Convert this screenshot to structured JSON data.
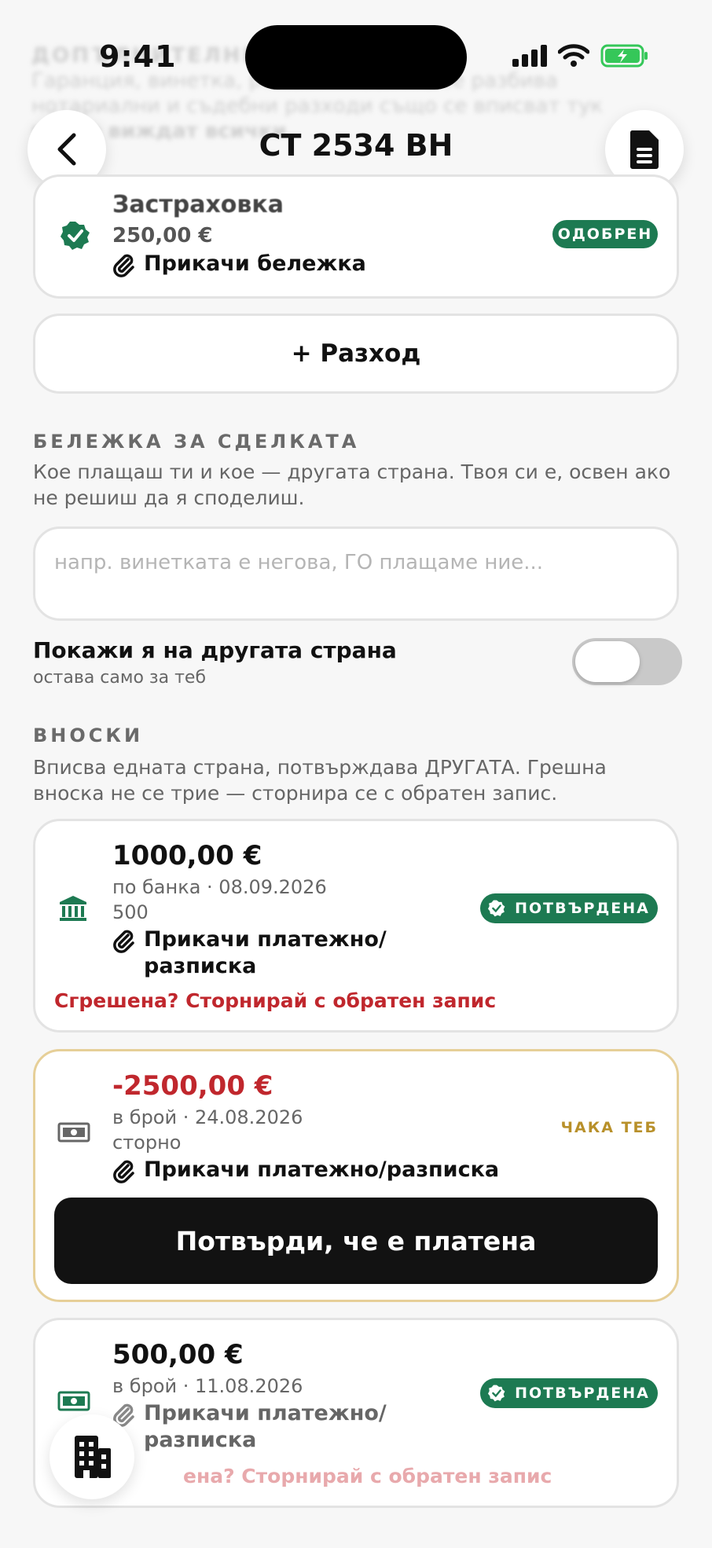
{
  "status_bar": {
    "time": "9:41"
  },
  "background_text": {
    "line1": "ДОПЪЛНИТЕЛНИ",
    "line2": "Гаранция, винетка, ремонт — всичко се разбива",
    "line3": "нотариални и съдебни разходи също се вписват тук",
    "line4": "ва, не виждат всички"
  },
  "header": {
    "title": "СТ 2534 ВН"
  },
  "expense": {
    "name": "Застраховка",
    "amount": "250,00 €",
    "attach_label": "Прикачи бележка",
    "badge": "ОДОБРЕН"
  },
  "add_expense_label": "+ Разход",
  "deal_note": {
    "heading": "БЕЛЕЖКА ЗА СДЕЛКАТА",
    "description": "Кое плащаш ти и кое — другата страна. Твоя си е, освен ако не решиш да я споделиш.",
    "placeholder": "напр. винетката е негова, ГО плащаме ние...",
    "share_label": "Покажи я на другата страна",
    "share_sub": "остава само за теб"
  },
  "payments": {
    "heading": "ВНОСКИ",
    "description": "Вписва едната страна, потвърждава ДРУГАТА. Грешна вноска не се трие — сторнира се с обратен запис.",
    "items": [
      {
        "amount": "1000,00 €",
        "meta": "по банка · 08.09.2026",
        "note": "500",
        "attach_label_1": "Прикачи платежно/",
        "attach_label_2": "разписка",
        "badge": "ПОТВЪРДЕНА",
        "storno_label": "Сгрешена? Сторнирай с обратен запис"
      },
      {
        "amount": "-2500,00 €",
        "meta": "в брой · 24.08.2026",
        "note": "сторно",
        "attach_label": "Прикачи платежно/разписка",
        "badge": "ЧАКА ТЕБ",
        "confirm_label": "Потвърди, че е платена"
      },
      {
        "amount": "500,00 €",
        "meta": "в брой · 11.08.2026",
        "attach_label_1": "Прикачи платежно/",
        "attach_label_2": "разписка",
        "badge": "ПОТВЪРДЕНА",
        "storno_label": "ена? Сторнирай с обратен запис"
      }
    ]
  },
  "colors": {
    "green": "#1d7a52",
    "red": "#c0272d",
    "gold": "#b8902a"
  },
  "icons": [
    "back-icon",
    "document-icon",
    "verified-icon",
    "paperclip-icon",
    "bank-icon",
    "cash-icon",
    "building-icon"
  ]
}
